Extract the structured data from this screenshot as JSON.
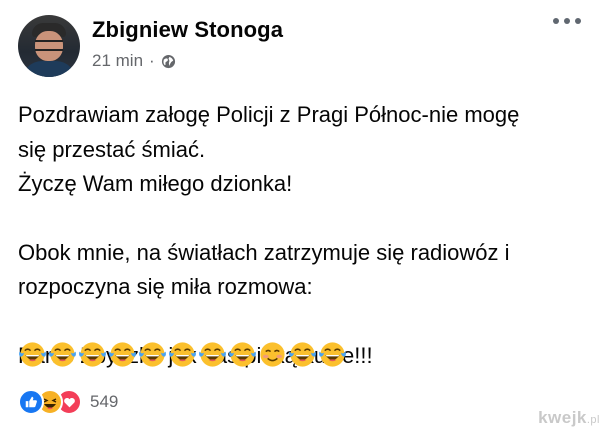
{
  "post": {
    "author": "Zbigniew Stonoga",
    "timestamp": "21 min",
    "separator": "·",
    "audience_icon": "globe-icon",
    "more_icon": "more-options-icon",
    "lines": [
      "Pozdrawiam załogę Policji z Pragi Północ-nie mogę",
      "się przestać śmiać.",
      "Życzę Wam miłego dzionka!",
      "",
      "Obok mnie, na światłach zatrzymuje się radiowóz i",
      "rozpoczyna się miła rozmowa:",
      "",
      "Panie Zbyszku jak nas pieką kukle!!!"
    ],
    "emojis": [
      "tears-of-joy",
      "tears-of-joy",
      "tears-of-joy",
      "tears-of-joy",
      "tears-of-joy",
      "tears-of-joy",
      "tears-of-joy",
      "tears-of-joy",
      "smiling-blush",
      "tears-of-joy",
      "tears-of-joy"
    ]
  },
  "reactions": {
    "types": [
      "like-icon",
      "haha-icon",
      "love-icon"
    ],
    "count": "549"
  },
  "watermark": {
    "text": "kwejk",
    "suffix": ".pl"
  },
  "colors": {
    "text": "#050505",
    "secondary": "#65676b",
    "like": "#1877f2",
    "haha": "#f7b125",
    "love": "#f33e58"
  }
}
